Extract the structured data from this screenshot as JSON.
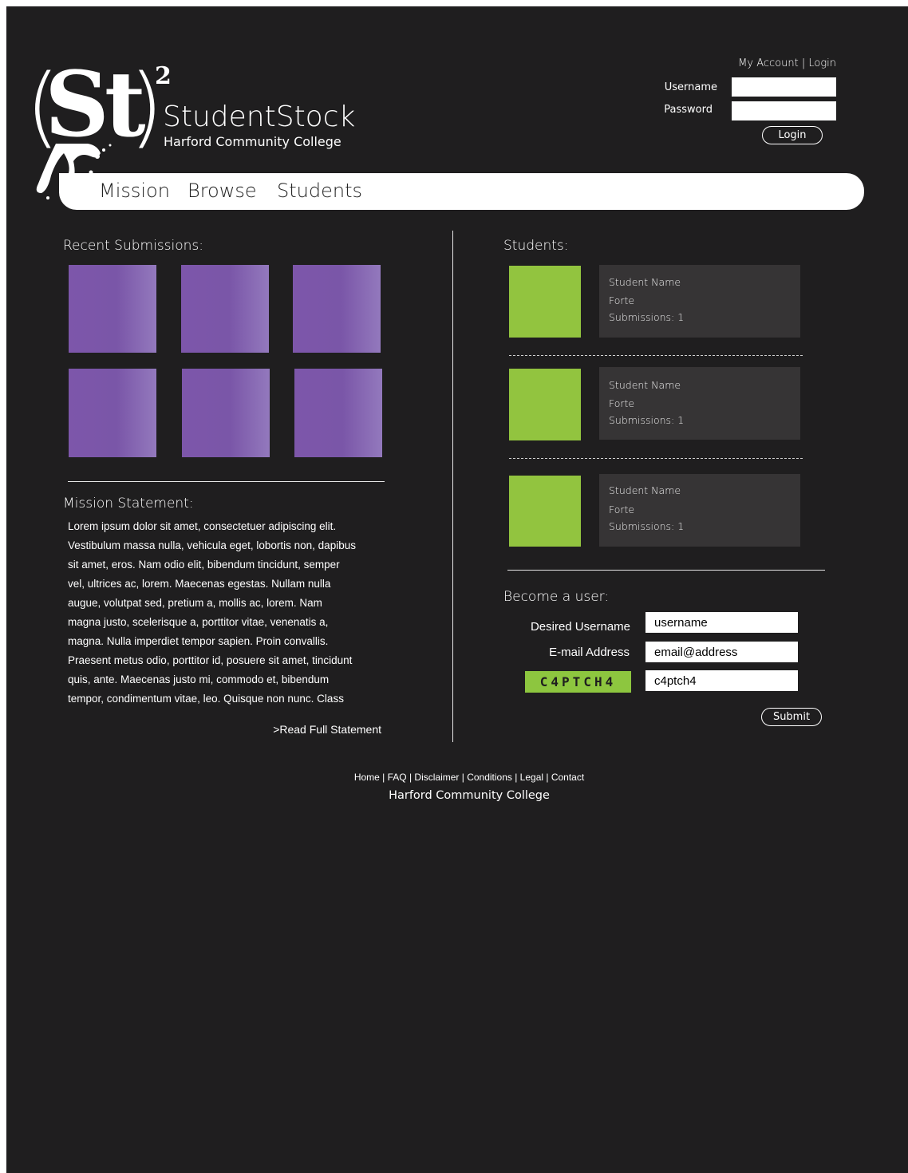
{
  "colors": {
    "background": "#1f1e1f",
    "nav_bar": "#ffffff",
    "thumbnail_purple": "#7d56aa",
    "student_green": "#92c43f",
    "student_card": "#363435",
    "captcha_green": "#8dc63f"
  },
  "brand": {
    "logo_letters": "St",
    "logo_superscript": "2",
    "name": "StudentStock",
    "subtitle": "Harford Community College"
  },
  "header": {
    "account_link": "My Account | Login",
    "username_label": "Username",
    "password_label": "Password",
    "username_value": "",
    "password_value": "",
    "login_button": "Login"
  },
  "nav": {
    "items": [
      {
        "label": "Mission"
      },
      {
        "label": "Browse"
      },
      {
        "label": "Students"
      }
    ]
  },
  "recent": {
    "title": "Recent Submissions:",
    "thumbnail_count": 6
  },
  "mission": {
    "title": "Mission Statement:",
    "lines": [
      "Lorem ipsum dolor sit amet, consectetuer adipiscing elit.",
      "Vestibulum massa nulla, vehicula eget, lobortis non, dapibus",
      "sit amet, eros. Nam odio elit, bibendum tincidunt, semper",
      "vel, ultrices ac, lorem. Maecenas egestas. Nullam nulla",
      "augue, volutpat sed, pretium a, mollis ac, lorem. Nam",
      "magna justo, scelerisque a, porttitor vitae, venenatis a,",
      "magna. Nulla imperdiet tempor sapien. Proin convallis.",
      "Praesent metus odio, porttitor id, posuere sit amet, tincidunt",
      "quis, ante. Maecenas justo mi, commodo et, bibendum",
      "tempor, condimentum vitae, leo. Quisque non nunc. Class"
    ],
    "read_more": ">Read Full Statement"
  },
  "students": {
    "title": "Students:",
    "items": [
      {
        "name": "Student Name",
        "forte": "Forte",
        "submissions": "Submissions: 1"
      },
      {
        "name": "Student Name",
        "forte": "Forte",
        "submissions": "Submissions: 1"
      },
      {
        "name": "Student Name",
        "forte": "Forte",
        "submissions": "Submissions: 1"
      }
    ]
  },
  "signup": {
    "title": "Become a user:",
    "username_label": "Desired Username",
    "username_value": "username",
    "email_label": "E-mail Address",
    "email_value": "email@address",
    "captcha_text": "C4PTCH4",
    "captcha_value": "c4ptch4",
    "submit_button": "Submit"
  },
  "footer": {
    "links": "Home | FAQ | Disclaimer | Conditions | Legal | Contact",
    "institution": "Harford Community College"
  }
}
